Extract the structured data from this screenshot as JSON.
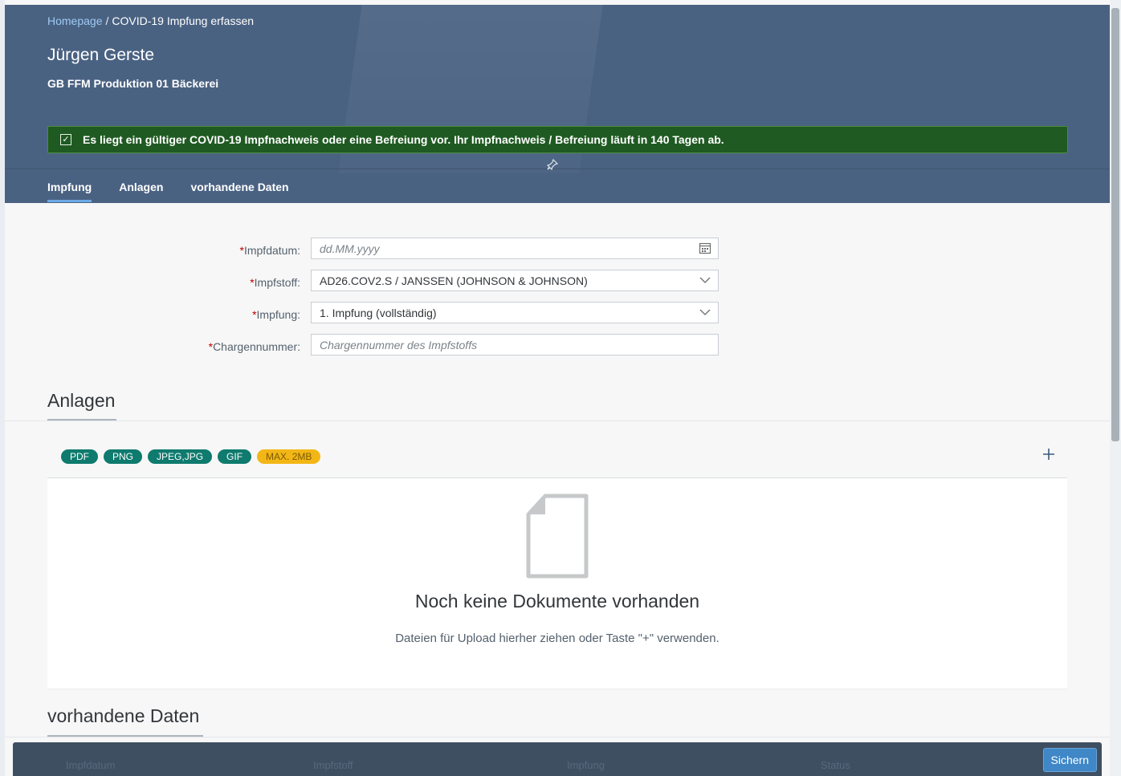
{
  "header": {
    "breadcrumb_home": "Homepage",
    "breadcrumb_separator": "/",
    "breadcrumb_current": "COVID-19 Impfung erfassen",
    "title": "Jürgen Gerste",
    "subtitle": "GB FFM Produktion 01 Bäckerei",
    "banner": "Es liegt ein gültiger COVID-19 Impfnachweis oder eine Befreiung vor. Ihr Impfnachweis / Befreiung läuft in 140 Tagen ab.",
    "pin_icon": "pin-icon",
    "tabs": [
      {
        "label": "Impfung",
        "active": true
      },
      {
        "label": "Anlagen",
        "active": false
      },
      {
        "label": "vorhandene Daten",
        "active": false
      }
    ]
  },
  "form": {
    "required_mark": "*",
    "impfdatum": {
      "label": "Impfdatum:",
      "placeholder": "dd.MM.yyyy",
      "icon": "calendar-icon"
    },
    "impfstoff": {
      "label": "Impfstoff:",
      "value": "AD26.COV2.S / JANSSEN (JOHNSON & JOHNSON)",
      "icon": "chevron-down-icon"
    },
    "impfung": {
      "label": "Impfung:",
      "value": "1. Impfung (vollständig)",
      "icon": "chevron-down-icon"
    },
    "charge": {
      "label": "Chargennummer:",
      "placeholder": "Chargennummer des Impfstoffs"
    }
  },
  "anlagen": {
    "title": "Anlagen",
    "file_types": [
      "PDF",
      "PNG",
      "JPEG,JPG",
      "GIF"
    ],
    "max_size": "MAX. 2MB",
    "add_icon": "plus-icon",
    "empty_title": "Noch keine Dokumente vorhanden",
    "empty_hint": "Dateien für Upload hierher ziehen oder Taste \"+\" verwenden."
  },
  "vorhandene": {
    "title": "vorhandene Daten",
    "columns": [
      "Impfdatum",
      "Impfstoff",
      "Impfung",
      "Status"
    ]
  },
  "footer": {
    "save_label": "Sichern"
  },
  "colors": {
    "header_bg": "#4a6282",
    "banner_bg": "#1f5a22",
    "accent": "#3f87c7",
    "pill": "#0f7a6e",
    "pill_warn": "#f2b616"
  }
}
